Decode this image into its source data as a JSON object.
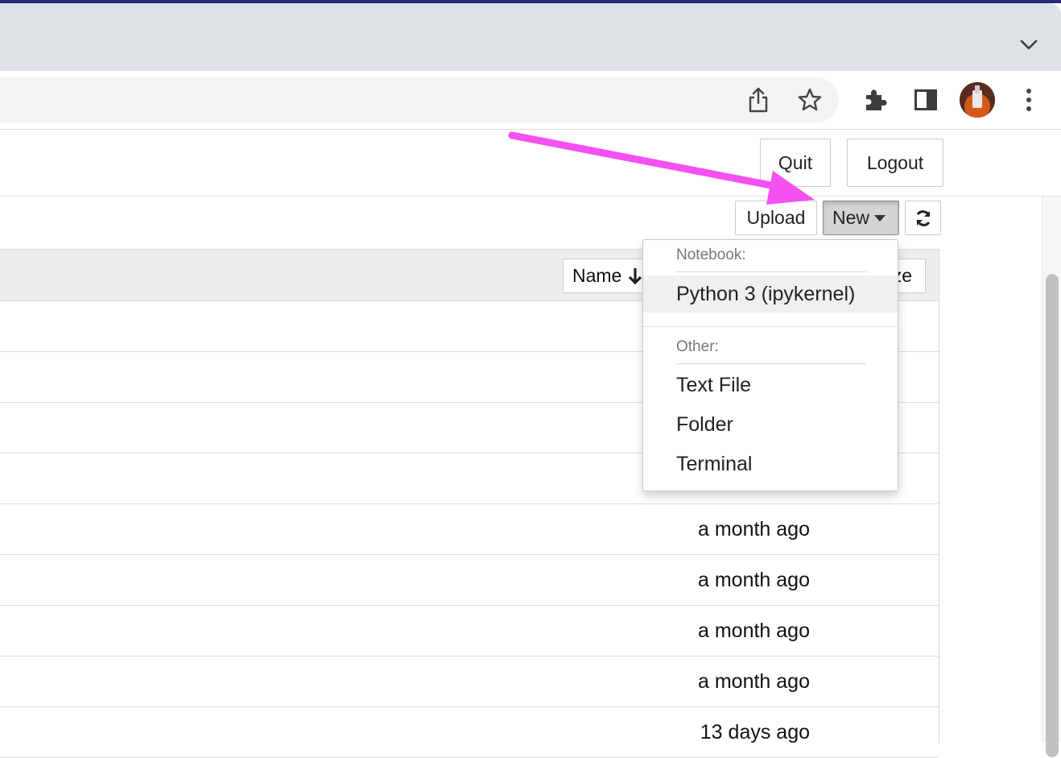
{
  "browser": {
    "icons": [
      "chevron-down-icon",
      "share-icon",
      "star-icon",
      "extensions-icon",
      "side-panel-icon",
      "avatar",
      "more-menu-icon"
    ]
  },
  "header": {
    "quit_label": "Quit",
    "logout_label": "Logout"
  },
  "toolbar": {
    "upload_label": "Upload",
    "new_label": "New",
    "refresh_icon": "refresh-icon"
  },
  "file_list": {
    "columns": {
      "name_label": "Name",
      "size_label": "ze"
    },
    "rows": [
      {
        "modified": ""
      },
      {
        "modified": ""
      },
      {
        "modified": ""
      },
      {
        "modified": ""
      },
      {
        "modified": "a month ago"
      },
      {
        "modified": "a month ago"
      },
      {
        "modified": "a month ago"
      },
      {
        "modified": "a month ago"
      },
      {
        "modified": "13 days ago"
      }
    ]
  },
  "new_menu": {
    "notebook_header": "Notebook:",
    "notebook_items": [
      "Python 3 (ipykernel)"
    ],
    "other_header": "Other:",
    "other_items": [
      "Text File",
      "Folder",
      "Terminal"
    ]
  },
  "annotation": {
    "arrow_color": "#f550f0"
  }
}
